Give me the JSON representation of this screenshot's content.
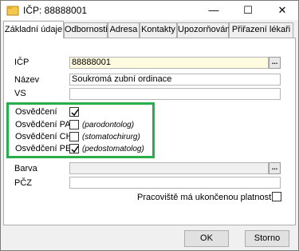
{
  "window": {
    "title": "IČP: 88888001",
    "minimize": "—",
    "maximize": "☐",
    "close": "✕"
  },
  "tabs": [
    {
      "label": "Základní údaje",
      "active": true
    },
    {
      "label": "Odbornosti"
    },
    {
      "label": "Adresa"
    },
    {
      "label": "Kontakty"
    },
    {
      "label": "Upozorňování"
    },
    {
      "label": "Přiřazení lékaři"
    }
  ],
  "form": {
    "icp_label": "IČP",
    "icp_value": "88888001",
    "nazev_label": "Název",
    "nazev_value": "Soukromá zubní ordinace",
    "vs_label": "VS",
    "vs_value": "",
    "osvedceni": [
      {
        "label": "Osvědčení",
        "checked": true,
        "hint": ""
      },
      {
        "label": "Osvědčení PA",
        "checked": false,
        "hint": "(parodontolog)"
      },
      {
        "label": "Osvědčení CH",
        "checked": false,
        "hint": "(stomatochirurg)"
      },
      {
        "label": "Osvědčení PE",
        "checked": true,
        "hint": "(pedostomatolog)"
      }
    ],
    "barva_label": "Barva",
    "pcz_label": "PČZ",
    "pcz_value": "",
    "ukoncena_label": "Pracoviště má ukončenou platnost",
    "ukoncena_checked": false,
    "dots": "..."
  },
  "footer": {
    "ok": "OK",
    "cancel": "Storno"
  },
  "colors": {
    "highlight": "#27ae4b",
    "icp_bg": "#fffbe0"
  }
}
